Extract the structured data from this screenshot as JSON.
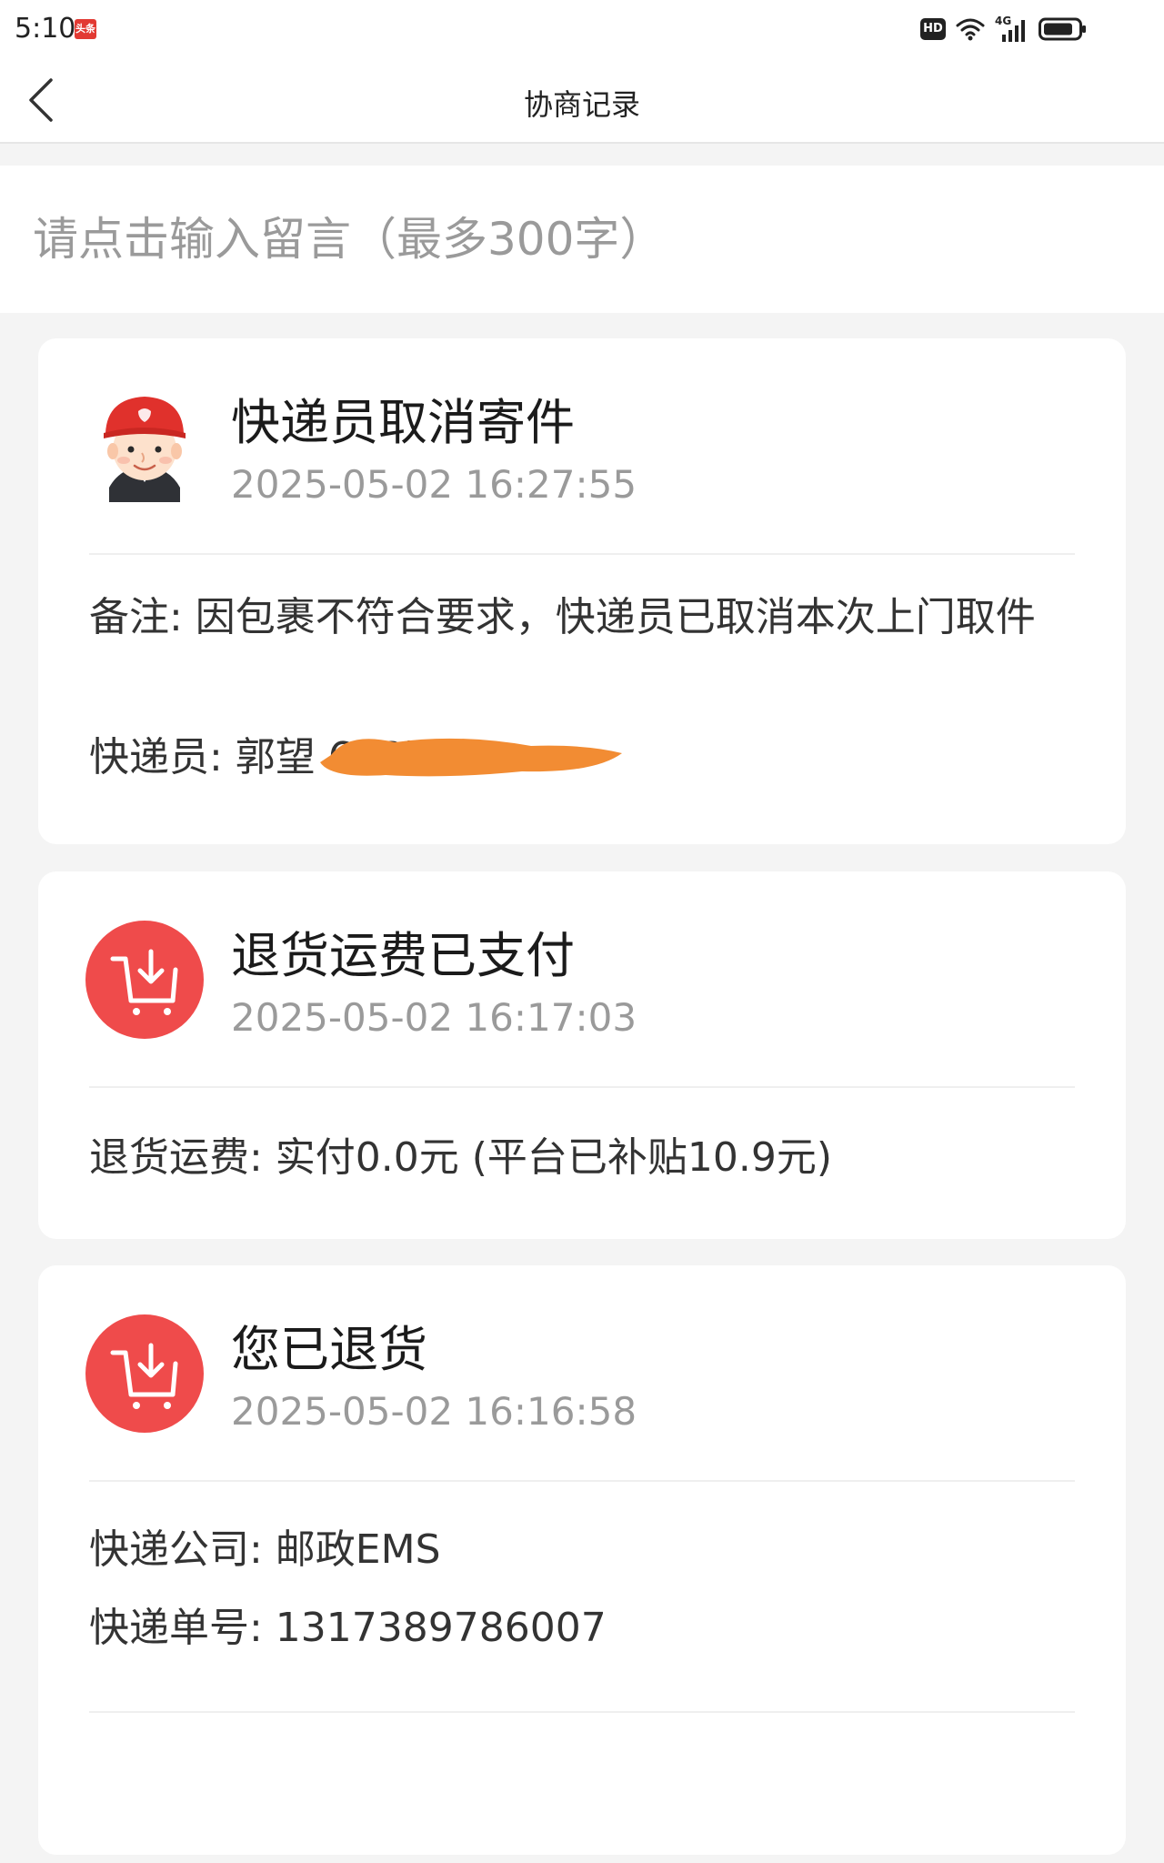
{
  "status_bar": {
    "time": "5:10",
    "app_badge": "头条",
    "hd_label": "HD",
    "network_label": "4G",
    "icons": [
      "app-badge-icon",
      "hd-icon",
      "wifi-icon",
      "signal-icon",
      "battery-icon"
    ]
  },
  "nav": {
    "title": "协商记录",
    "back_icon": "chevron-left-icon"
  },
  "message_input": {
    "placeholder": "请点击输入留言（最多300字）",
    "value": ""
  },
  "records": [
    {
      "icon": "courier-avatar-icon",
      "title": "快递员取消寄件",
      "time": "2025-05-02 16:27:55",
      "lines": [
        "备注: 因包裹不符合要求，快递员已取消本次上门取件",
        "快递员: 郭望            678)"
      ]
    },
    {
      "icon": "return-cart-icon",
      "title": "退货运费已支付",
      "time": "2025-05-02 16:17:03",
      "lines": [
        "退货运费: 实付0.0元 (平台已补贴10.9元)"
      ]
    },
    {
      "icon": "return-cart-icon",
      "title": "您已退货",
      "time": "2025-05-02 16:16:58",
      "lines": [
        "快递公司: 邮政EMS",
        "快递单号: 1317389786007"
      ]
    }
  ],
  "colors": {
    "accent_red": "#ef4b4b",
    "redaction_orange": "#f28c33",
    "muted_text": "#9a9a9a",
    "page_bg": "#f4f4f4"
  }
}
